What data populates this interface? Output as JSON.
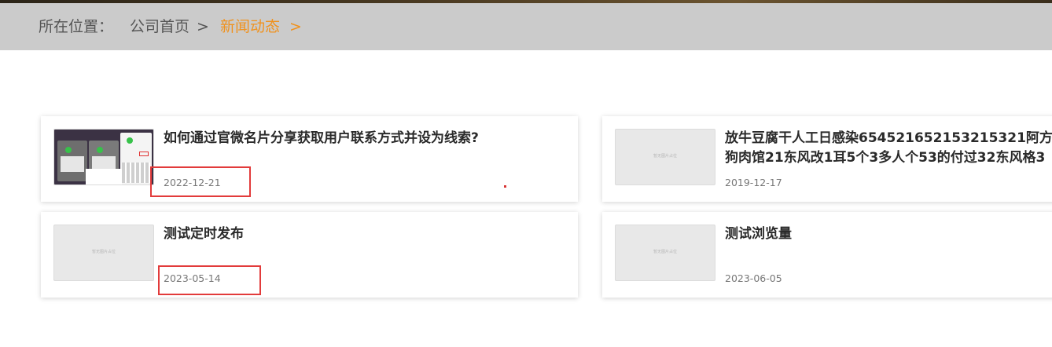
{
  "breadcrumb": {
    "label": "所在位置：",
    "home": "公司首页",
    "separator": ">",
    "current": "新闻动态",
    "current_separator": ">"
  },
  "colors": {
    "accent": "#f0921e",
    "breadcrumb_bg": "#cbcbcb",
    "highlight_border": "#e23b3b"
  },
  "news": [
    {
      "title": "如何通过官微名片分享获取用户联系方式并设为线索?",
      "date": "2022-12-21",
      "thumbnail": "app-screenshot"
    },
    {
      "title_line1": "放牛豆腐干人工日感染654521652153215321阿方",
      "title_line2": "狗肉馆21东风改1耳5个3多人个53的付过32东风格3",
      "date": "2019-12-17",
      "thumbnail": "placeholder"
    },
    {
      "title": "测试定时发布",
      "date": "2023-05-14",
      "thumbnail": "placeholder"
    },
    {
      "title": "测试浏览量",
      "date": "2023-06-05",
      "thumbnail": "placeholder"
    }
  ]
}
